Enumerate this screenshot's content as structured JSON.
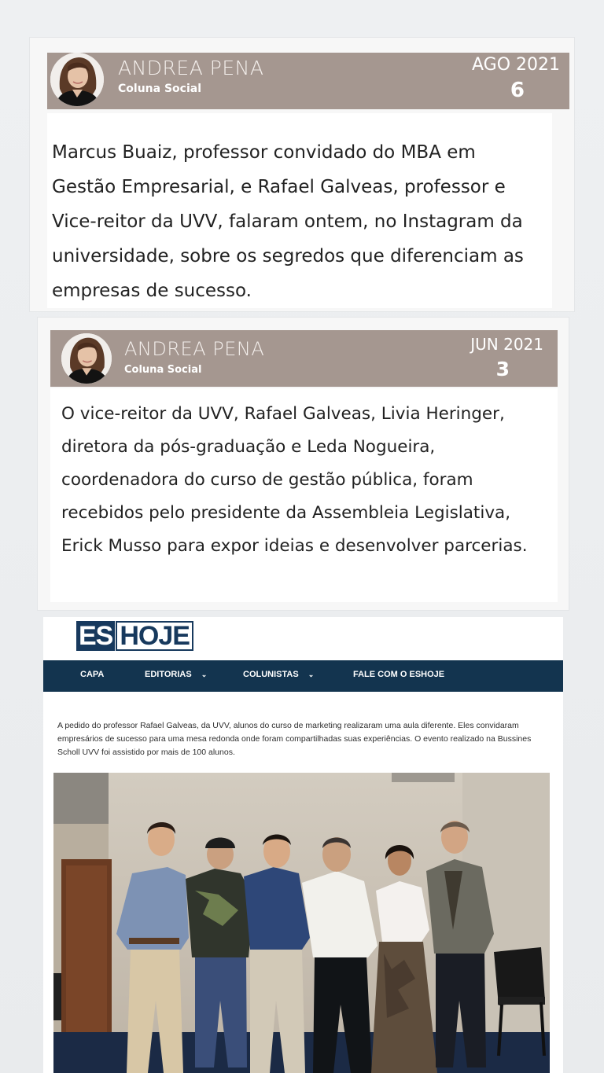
{
  "posts": [
    {
      "author": "ANDREA PENA",
      "column": "Coluna Social",
      "month_year": "AGO 2021",
      "day": "6",
      "text": "Marcus Buaiz, professor convidado do MBA em Gestão Empresarial, e Rafael Galveas, professor e Vice-reitor da UVV, falaram ontem, no Instagram da universidade, sobre os segredos que diferenciam as empresas de sucesso."
    },
    {
      "author": "ANDREA PENA",
      "column": "Coluna Social",
      "month_year": "JUN 2021",
      "day": "3",
      "text": "O vice-reitor da UVV, Rafael Galveas, Livia Heringer, diretora da pós-graduação e Leda Nogueira, coordenadora do curso de gestão pública, foram recebidos pelo presidente da Assembleia Legislativa, Erick Musso para expor ideias e desenvolver parcerias."
    }
  ],
  "news_site": {
    "logo_es": "ES",
    "logo_hoje": "HOJE",
    "nav": [
      "CAPA",
      "EDITORIAS",
      "COLUNISTAS",
      "FALE COM O ESHOJE"
    ],
    "caption": "A pedido do professor Rafael Galveas, da UVV, alunos do curso de marketing realizaram uma aula diferente. Eles convidaram empresários de sucesso para uma mesa redonda onde foram compartilhadas suas experiências. O evento realizado na Bussines Scholl UVV foi assistido por mais de 100 alunos.",
    "icons": {
      "dropdown": "chevron-down-icon"
    }
  },
  "colors": {
    "header_bg": "#a59790",
    "nav_bg": "#13344f",
    "logo_blue": "#17395d"
  }
}
